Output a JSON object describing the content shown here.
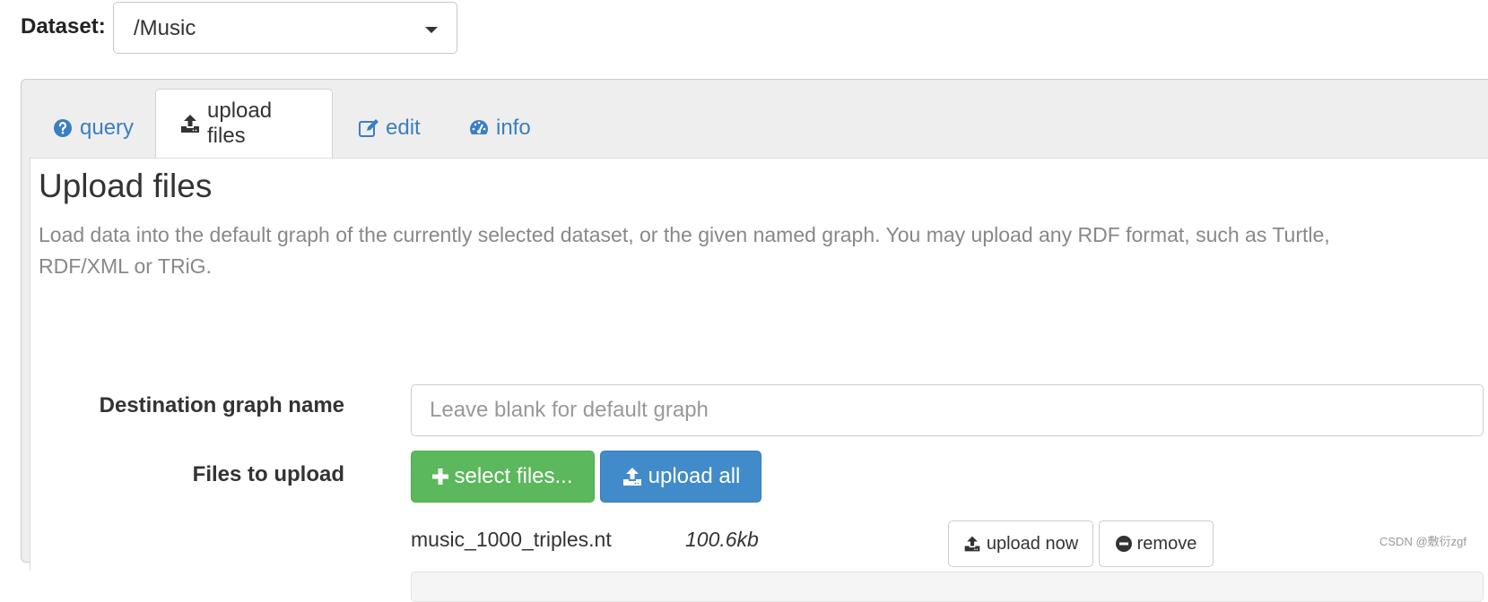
{
  "dataset": {
    "label": "Dataset:",
    "selected": "/Music"
  },
  "tabs": [
    {
      "label": "query",
      "icon": "question-circle-icon",
      "active": false
    },
    {
      "label": "upload files",
      "icon": "upload-icon",
      "active": true
    },
    {
      "label": "edit",
      "icon": "edit-icon",
      "active": false
    },
    {
      "label": "info",
      "icon": "dashboard-icon",
      "active": false
    }
  ],
  "upload": {
    "title": "Upload files",
    "description": "Load data into the default graph of the currently selected dataset, or the given named graph. You may upload any RDF format, such as Turtle, RDF/XML or TRiG.",
    "destination_label": "Destination graph name",
    "destination_placeholder": "Leave blank for default graph",
    "destination_value": "",
    "files_label": "Files to upload",
    "select_button": "select files...",
    "upload_all_button": "upload all"
  },
  "files": [
    {
      "name": "music_1000_triples.nt",
      "size": "100.6kb",
      "upload_now": "upload now",
      "remove": "remove",
      "progress": 0
    }
  ],
  "watermark": "CSDN @敷衍zgf",
  "colors": {
    "link": "#3a7fc1",
    "success": "#5cb85c",
    "primary": "#428bca",
    "muted": "#888888"
  }
}
